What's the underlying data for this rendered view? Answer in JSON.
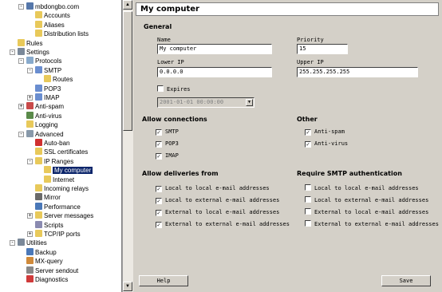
{
  "tree": {
    "items": [
      {
        "label": "mbdongbo.com",
        "depth": 1,
        "icon": "domain-icon",
        "color": "#5577aa",
        "exp": "-"
      },
      {
        "label": "Accounts",
        "depth": 2,
        "icon": "folder-icon",
        "color": "#e8c95a"
      },
      {
        "label": "Aliases",
        "depth": 2,
        "icon": "folder-icon",
        "color": "#e8c95a"
      },
      {
        "label": "Distribution lists",
        "depth": 2,
        "icon": "folder-icon",
        "color": "#e8c95a"
      },
      {
        "label": "Rules",
        "depth": 0,
        "icon": "folder-icon",
        "color": "#e8c95a"
      },
      {
        "label": "Settings",
        "depth": 0,
        "icon": "tools-icon",
        "color": "#7a8899",
        "exp": "-"
      },
      {
        "label": "Protocols",
        "depth": 1,
        "icon": "protocol-icon",
        "color": "#88aacc",
        "exp": "-"
      },
      {
        "label": "SMTP",
        "depth": 2,
        "icon": "feather-icon",
        "color": "#6a8ed0",
        "exp": "-"
      },
      {
        "label": "Routes",
        "depth": 3,
        "icon": "folder-icon",
        "color": "#e8c95a"
      },
      {
        "label": "POP3",
        "depth": 2,
        "icon": "feather-icon",
        "color": "#6a8ed0"
      },
      {
        "label": "IMAP",
        "depth": 2,
        "icon": "feather-icon",
        "color": "#6a8ed0",
        "exp": "+"
      },
      {
        "label": "Anti-spam",
        "depth": 1,
        "icon": "antispam-icon",
        "color": "#c84a4a",
        "exp": "+"
      },
      {
        "label": "Anti-virus",
        "depth": 1,
        "icon": "antivirus-icon",
        "color": "#5a8a4a"
      },
      {
        "label": "Logging",
        "depth": 1,
        "icon": "folder-icon",
        "color": "#e8c95a"
      },
      {
        "label": "Advanced",
        "depth": 1,
        "icon": "magnifier-icon",
        "color": "#8899aa",
        "exp": "-"
      },
      {
        "label": "Auto-ban",
        "depth": 2,
        "icon": "ban-icon",
        "color": "#d03030"
      },
      {
        "label": "SSL certificates",
        "depth": 2,
        "icon": "folder-icon",
        "color": "#e8c95a"
      },
      {
        "label": "IP Ranges",
        "depth": 2,
        "icon": "folder-icon",
        "color": "#e8c95a",
        "exp": "-"
      },
      {
        "label": "My computer",
        "depth": 3,
        "icon": "folder-icon",
        "color": "#e8c95a",
        "selected": true
      },
      {
        "label": "Internet",
        "depth": 3,
        "icon": "folder-icon",
        "color": "#e8c95a"
      },
      {
        "label": "Incoming relays",
        "depth": 2,
        "icon": "folder-icon",
        "color": "#e8c95a"
      },
      {
        "label": "Mirror",
        "depth": 2,
        "icon": "mirror-icon",
        "color": "#6a6a6a"
      },
      {
        "label": "Performance",
        "depth": 2,
        "icon": "performance-icon",
        "color": "#4a78b8"
      },
      {
        "label": "Server messages",
        "depth": 2,
        "icon": "folder-icon",
        "color": "#e8c95a",
        "exp": "+"
      },
      {
        "label": "Scripts",
        "depth": 2,
        "icon": "scripts-icon",
        "color": "#8a8ab0"
      },
      {
        "label": "TCP/IP ports",
        "depth": 2,
        "icon": "folder-icon",
        "color": "#e8c95a",
        "exp": "+"
      },
      {
        "label": "Utilities",
        "depth": 0,
        "icon": "utilities-icon",
        "color": "#7a8899",
        "exp": "-"
      },
      {
        "label": "Backup",
        "depth": 1,
        "icon": "backup-icon",
        "color": "#4a78b8"
      },
      {
        "label": "MX-query",
        "depth": 1,
        "icon": "mxquery-icon",
        "color": "#d08a3a"
      },
      {
        "label": "Server sendout",
        "depth": 1,
        "icon": "sendout-icon",
        "color": "#888888"
      },
      {
        "label": "Diagnostics",
        "depth": 1,
        "icon": "diagnostics-icon",
        "color": "#d03a3a"
      }
    ]
  },
  "panel": {
    "title": "My computer",
    "general": {
      "heading": "General",
      "name_label": "Name",
      "name_value": "My computer",
      "priority_label": "Priority",
      "priority_value": "15",
      "lower_ip_label": "Lower IP",
      "lower_ip_value": "0.0.0.0",
      "upper_ip_label": "Upper IP",
      "upper_ip_value": "255.255.255.255",
      "expires_label": "Expires",
      "expires_checked": false,
      "expires_value": "2001-01-01 00:00:00"
    },
    "allow_connections": {
      "heading": "Allow connections",
      "items": [
        {
          "label": "SMTP",
          "checked": true
        },
        {
          "label": "POP3",
          "checked": true
        },
        {
          "label": "IMAP",
          "checked": true
        }
      ]
    },
    "other": {
      "heading": "Other",
      "items": [
        {
          "label": "Anti-spam",
          "checked": true
        },
        {
          "label": "Anti-virus",
          "checked": true
        }
      ]
    },
    "allow_deliveries": {
      "heading": "Allow deliveries from",
      "items": [
        {
          "label": "Local to local e-mail addresses",
          "checked": true
        },
        {
          "label": "Local to external e-mail addresses",
          "checked": true
        },
        {
          "label": "External to local e-mail addresses",
          "checked": true
        },
        {
          "label": "External to external e-mail addresses",
          "checked": true
        }
      ]
    },
    "require_smtp_auth": {
      "heading": "Require SMTP authentication",
      "items": [
        {
          "label": "Local to local e-mail addresses",
          "checked": false
        },
        {
          "label": "Local to external e-mail addresses",
          "checked": false
        },
        {
          "label": "External to local e-mail addresses",
          "checked": false
        },
        {
          "label": "External to external e-mail addresses",
          "checked": false
        }
      ]
    },
    "help_label": "Help",
    "save_label": "Save"
  }
}
